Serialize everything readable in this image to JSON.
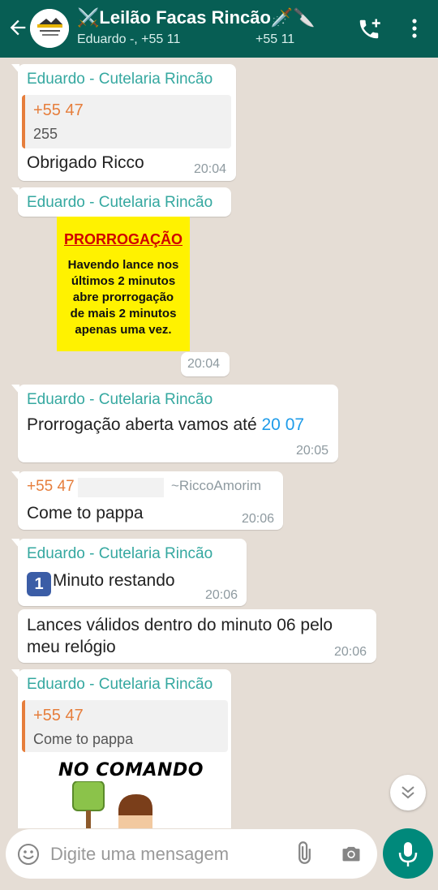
{
  "header": {
    "title": "⚔️Leilão Facas Rincão🗡️🔪",
    "subtitle_left": "Eduardo -, +55 11",
    "subtitle_right": "+55 11"
  },
  "messages": {
    "m1": {
      "sender": "Eduardo - Cutelaria Rincão",
      "quote_name": "+55 47",
      "quote_text": "255",
      "text": "Obrigado Ricco",
      "time": "20:04"
    },
    "m2": {
      "sender": "Eduardo - Cutelaria Rincão",
      "poster_title": "PRORROGAÇÃO",
      "poster_line1": "Havendo lance nos",
      "poster_line2": "últimos 2 minutos",
      "poster_line3": "abre prorrogação",
      "poster_line4": "de mais 2 minutos",
      "poster_line5": "apenas uma vez.",
      "time": "20:04"
    },
    "m3": {
      "sender": "Eduardo - Cutelaria Rincão",
      "text": "Prorrogação aberta vamos até ",
      "link": "20 07",
      "time": "20:05"
    },
    "m4": {
      "sender": "+55 47",
      "alias": "~RiccoAmorim",
      "text": "Come to pappa",
      "time": "20:06"
    },
    "m5": {
      "sender": "Eduardo - Cutelaria Rincão",
      "badge": "1",
      "text": "Minuto restando",
      "time": "20:06"
    },
    "m6": {
      "line1": "Lances válidos dentro do minuto 06 pelo",
      "line2": "meu relógio",
      "time": "20:06"
    },
    "m7": {
      "sender": "Eduardo - Cutelaria Rincão",
      "quote_name": "+55 47",
      "quote_text": "Come to pappa",
      "sticker_text": "NO COMANDO"
    }
  },
  "input": {
    "placeholder": "Digite uma mensagem"
  },
  "colors": {
    "header": "#075e54",
    "chat_bg": "#e5ddd5",
    "sender": "#35a8a0",
    "quote_accent": "#e67e3c",
    "mic": "#00897b"
  }
}
